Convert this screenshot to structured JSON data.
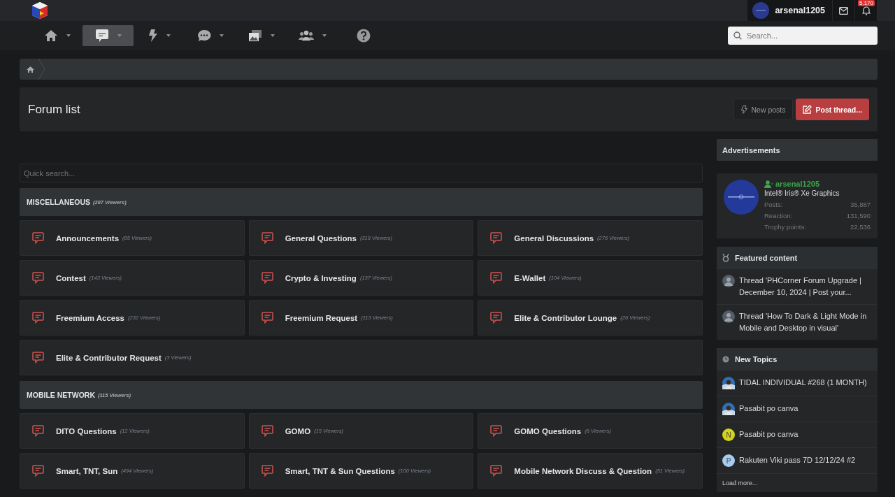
{
  "header": {
    "username": "arsenal1205",
    "notification_count": "5,170"
  },
  "nav": [
    {
      "kind": "home",
      "selected": false,
      "dropdown": true
    },
    {
      "kind": "forums",
      "selected": true,
      "dropdown": true
    },
    {
      "kind": "new",
      "selected": false,
      "dropdown": true
    },
    {
      "kind": "chat",
      "selected": false,
      "dropdown": true
    },
    {
      "kind": "media",
      "selected": false,
      "dropdown": true
    },
    {
      "kind": "members",
      "selected": false,
      "dropdown": true
    },
    {
      "kind": "help",
      "selected": false,
      "dropdown": false
    }
  ],
  "search": {
    "placeholder": "Search..."
  },
  "page_title": "Forum list",
  "actions": [
    {
      "kind": "secondary",
      "label": "New posts"
    },
    {
      "kind": "primary",
      "label": "Post thread..."
    }
  ],
  "quick_search": {
    "placeholder": "Quick search..."
  },
  "categories": [
    {
      "title": "MISCELLANEOUS",
      "viewers": "(287 Viewers)",
      "forums": [
        {
          "name": "Announcements",
          "viewers": "(85 Viewers)"
        },
        {
          "name": "General Questions",
          "viewers": "(319 Viewers)"
        },
        {
          "name": "General Discussions",
          "viewers": "(276 Viewers)"
        },
        {
          "name": "Contest",
          "viewers": "(143 Viewers)"
        },
        {
          "name": "Crypto & Investing",
          "viewers": "(137 Viewers)"
        },
        {
          "name": "E-Wallet",
          "viewers": "(104 Viewers)"
        },
        {
          "name": "Freemium Access",
          "viewers": "(232 Viewers)"
        },
        {
          "name": "Freemium Request",
          "viewers": "(113 Viewers)"
        },
        {
          "name": "Elite & Contributor Lounge",
          "viewers": "(26 Viewers)"
        },
        {
          "name": "Elite & Contributor Request",
          "viewers": "(3 Viewers)"
        }
      ]
    },
    {
      "title": "MOBILE NETWORK",
      "viewers": "(115 Viewers)",
      "forums": [
        {
          "name": "DITO Questions",
          "viewers": "(12 Viewers)"
        },
        {
          "name": "GOMO",
          "viewers": "(15 Viewers)"
        },
        {
          "name": "GOMO Questions",
          "viewers": "(6 Viewers)"
        },
        {
          "name": "Smart, TNT, Sun",
          "viewers": "(494 Viewers)"
        },
        {
          "name": "Smart, TNT & Sun Questions",
          "viewers": "(100 Viewers)"
        },
        {
          "name": "Mobile Network Discuss & Question",
          "viewers": "(51 Viewers)"
        }
      ]
    }
  ],
  "sidebar": {
    "advertisements_title": "Advertisements",
    "profile": {
      "username": "arsenal1205",
      "title": "Intel® Iris® Xe Graphics",
      "stats": [
        {
          "label": "Posts:",
          "value": "35,887"
        },
        {
          "label": "Reaction:",
          "value": "131,590"
        },
        {
          "label": "Trophy points:",
          "value": "22,536"
        }
      ]
    },
    "featured": {
      "title": "Featured content",
      "items": [
        {
          "text": "Thread 'PHCorner Forum Upgrade | December 10, 2024 | Post your..."
        },
        {
          "text": "Thread 'How To Dark & Light Mode in Mobile and Desktop in visual'"
        }
      ]
    },
    "new_topics": {
      "title": "New Topics",
      "items": [
        {
          "text": "TIDAL INDIVIDUAL #268 (1 MONTH)"
        },
        {
          "text": "Pasabit po canva"
        },
        {
          "text": "Pasabit po canva",
          "avatar": {
            "kind": "letter",
            "letter": "N",
            "color": "#d4d41c"
          }
        },
        {
          "text": "Rakuten Viki pass 7D 12/12/24 #2",
          "avatar": {
            "kind": "letter",
            "letter": "P",
            "color": "#a9cbf0"
          }
        }
      ],
      "load_more": "Load more..."
    }
  }
}
